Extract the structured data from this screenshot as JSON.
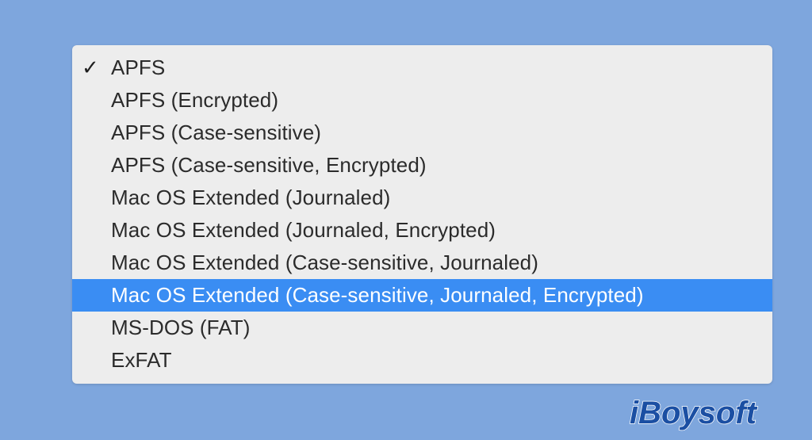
{
  "menu": {
    "items": [
      {
        "label": "APFS",
        "checked": true,
        "highlighted": false
      },
      {
        "label": "APFS (Encrypted)",
        "checked": false,
        "highlighted": false
      },
      {
        "label": "APFS (Case-sensitive)",
        "checked": false,
        "highlighted": false
      },
      {
        "label": "APFS (Case-sensitive, Encrypted)",
        "checked": false,
        "highlighted": false
      },
      {
        "label": "Mac OS Extended (Journaled)",
        "checked": false,
        "highlighted": false
      },
      {
        "label": "Mac OS Extended (Journaled, Encrypted)",
        "checked": false,
        "highlighted": false
      },
      {
        "label": "Mac OS Extended (Case-sensitive, Journaled)",
        "checked": false,
        "highlighted": false
      },
      {
        "label": "Mac OS Extended (Case-sensitive, Journaled, Encrypted)",
        "checked": false,
        "highlighted": true
      },
      {
        "label": "MS-DOS (FAT)",
        "checked": false,
        "highlighted": false
      },
      {
        "label": "ExFAT",
        "checked": false,
        "highlighted": false
      }
    ],
    "checkmark_glyph": "✓"
  },
  "watermark": {
    "text": "iBoysoft"
  },
  "colors": {
    "background": "#7ea6dd",
    "menu_background": "#ededed",
    "highlight": "#3a8df3",
    "logo": "#1b4fa3"
  }
}
